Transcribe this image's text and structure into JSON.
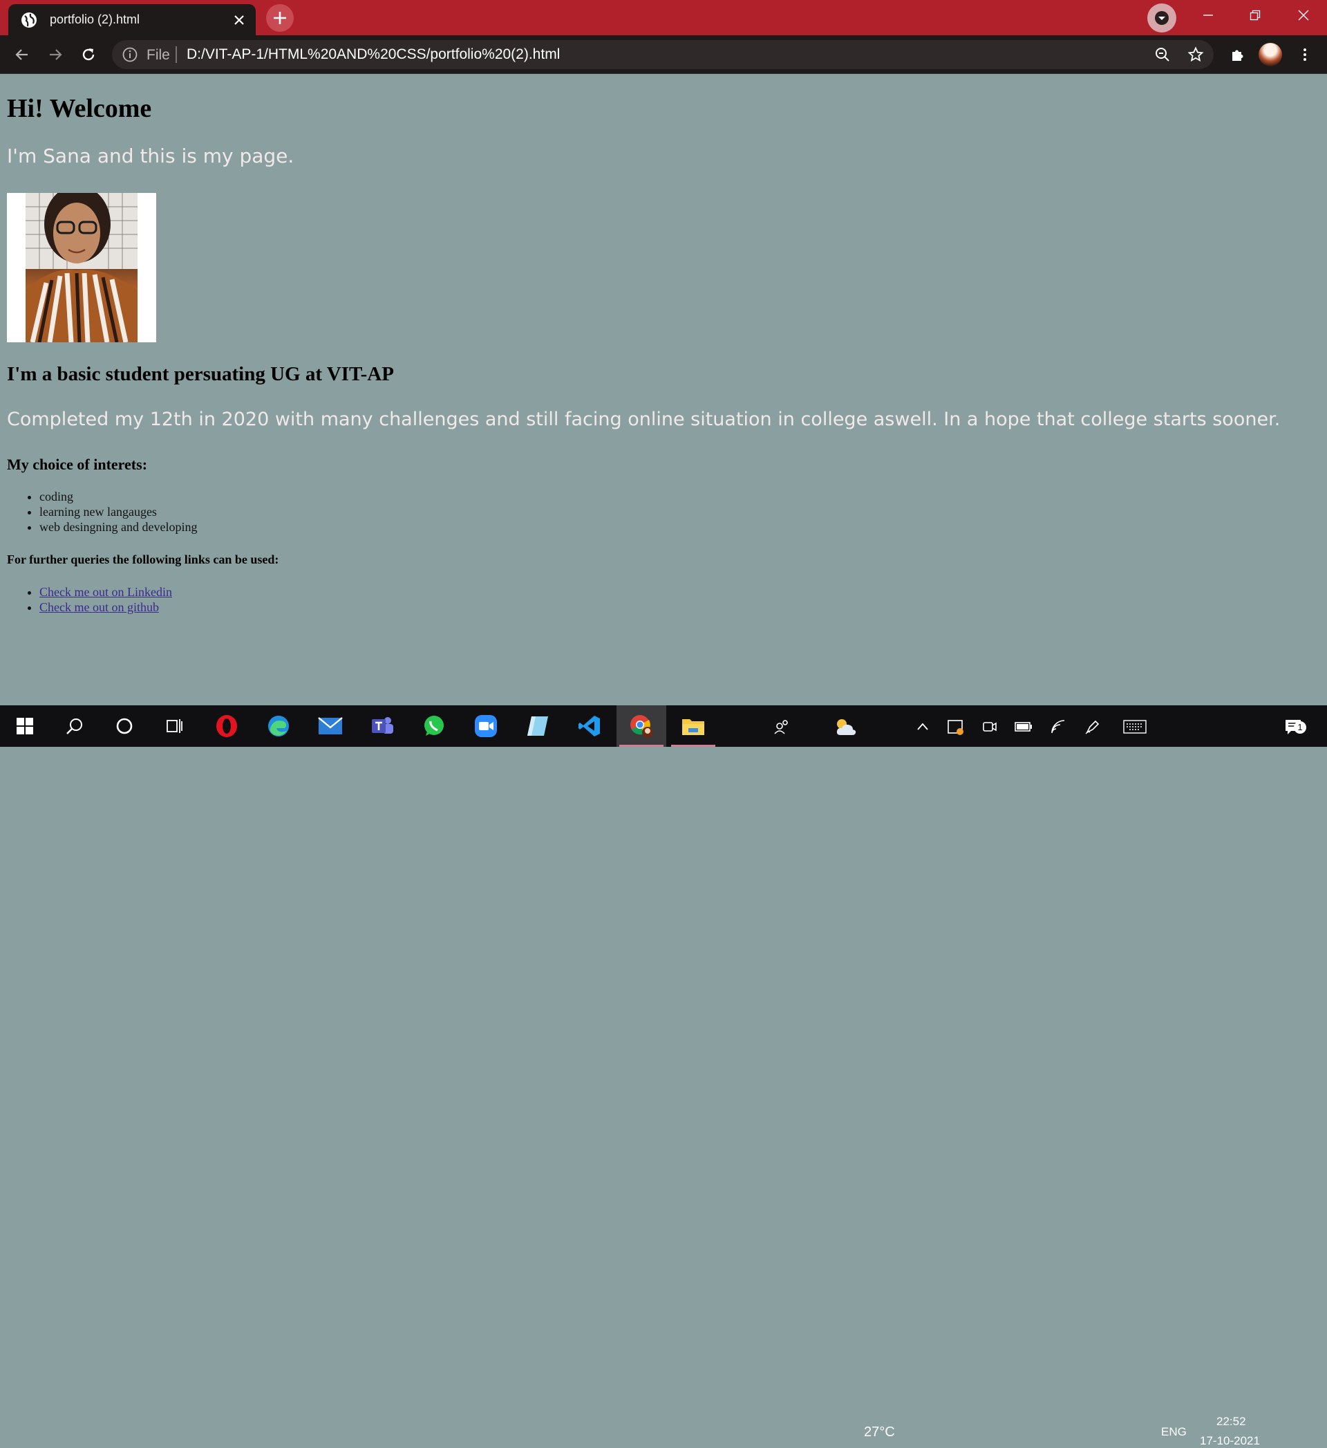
{
  "browser": {
    "tab": {
      "title": "portfolio (2).html",
      "favicon": "globe-icon"
    },
    "new_tab": "plus-icon",
    "address": {
      "scheme_label": "File",
      "url": "D:/VIT-AP-1/HTML%20AND%20CSS/portfolio%20(2).html"
    },
    "colors": {
      "titlebar": "#b0212c",
      "toolbar": "#1f1a1a"
    }
  },
  "page": {
    "background": "#8aa0a0",
    "heading": "Hi! Welcome",
    "intro": "I'm Sana and this is my page.",
    "student_heading": "I'm a basic student persuating UG at VIT-AP",
    "completed": "Completed my 12th in 2020 with many challenges and still facing online situation in college aswell. In a hope that college starts sooner.",
    "interests_heading": "My choice of interets:",
    "interests": [
      "coding",
      "learning new langauges",
      "web desingning and developing"
    ],
    "queries_heading": "For further queries the following links can be used:",
    "links": [
      {
        "label": "Check me out on Linkedin"
      },
      {
        "label": "Check me out on github"
      }
    ]
  },
  "taskbar": {
    "weather_temp": "27°C",
    "language": "ENG",
    "time": "22:52",
    "date": "17-10-2021",
    "notification_count": "1"
  }
}
